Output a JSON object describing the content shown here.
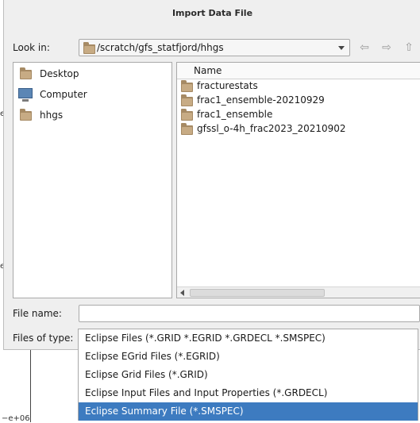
{
  "background": {
    "tick_label": "e+06",
    "left_fragments": [
      "e",
      "e"
    ]
  },
  "dialog": {
    "title": "Import Data File",
    "look_in_label": "Look in:",
    "look_in_path": "/scratch/gfs_statfjord/hhgs",
    "sidebar_items": [
      {
        "label": "Desktop",
        "icon": "folder-icon"
      },
      {
        "label": "Computer",
        "icon": "computer-icon"
      },
      {
        "label": "hhgs",
        "icon": "folder-icon"
      }
    ],
    "file_list": {
      "column_header": "Name",
      "rows": [
        "fracturestats",
        "frac1_ensemble-20210929",
        "frac1_ensemble",
        "gfssl_o-4h_frac2023_20210902"
      ]
    },
    "file_name_label": "File name:",
    "file_name_value": "",
    "files_of_type_label": "Files of type:",
    "file_type_options": [
      "Eclipse Files (*.GRID *.EGRID *.GRDECL *.SMSPEC)",
      "Eclipse EGrid Files (*.EGRID)",
      "Eclipse Grid Files (*.GRID)",
      "Eclipse Input Files and Input Properties (*.GRDECL)",
      "Eclipse Summary File (*.SMSPEC)"
    ],
    "selected_file_type": "Eclipse Summary File (*.SMSPEC)",
    "selection_color": "#3d7bc0"
  }
}
